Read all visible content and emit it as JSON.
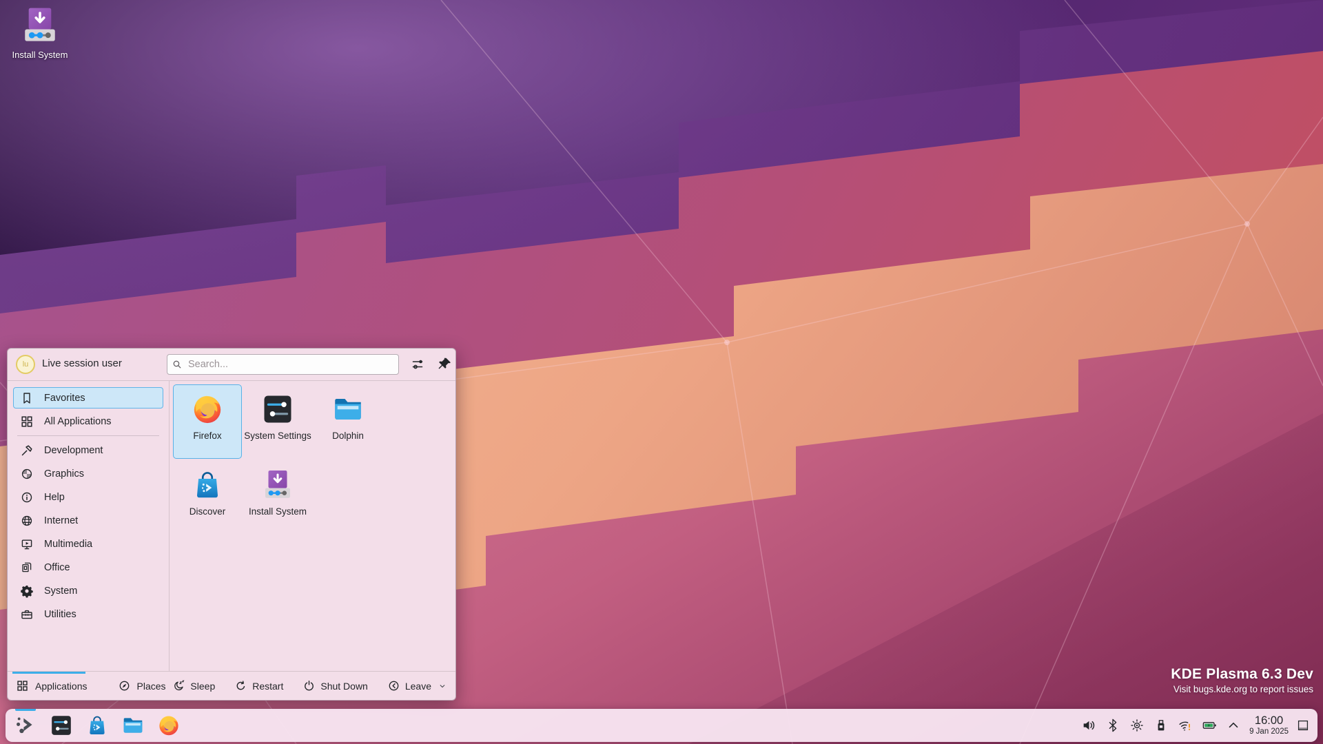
{
  "colors": {
    "accent": "#3daee9",
    "panel_bg": "#f6e3ef",
    "menu_bg": "#f3dee9",
    "highlight_bg": "#cde7f8",
    "text": "#232629",
    "network_warning": "#f39c1f",
    "battery_charge": "#2ea95c"
  },
  "desktop": {
    "install_icon_label": "Install System",
    "branding_title": "KDE Plasma 6.3 Dev",
    "branding_subtitle": "Visit bugs.kde.org to report issues"
  },
  "launcher": {
    "user_name": "Live session user",
    "avatar_initials": "lu",
    "search_placeholder": "Search...",
    "header_buttons": [
      {
        "name": "configure-icon"
      },
      {
        "name": "pin-icon"
      }
    ],
    "sidebar": [
      {
        "label": "Favorites",
        "icon": "bookmark",
        "selected": true
      },
      {
        "label": "All Applications",
        "icon": "grid",
        "divider_after": true
      },
      {
        "label": "Development",
        "icon": "hammer"
      },
      {
        "label": "Graphics",
        "icon": "checker"
      },
      {
        "label": "Help",
        "icon": "info"
      },
      {
        "label": "Internet",
        "icon": "globe"
      },
      {
        "label": "Multimedia",
        "icon": "multimedia"
      },
      {
        "label": "Office",
        "icon": "office"
      },
      {
        "label": "System",
        "icon": "gear"
      },
      {
        "label": "Utilities",
        "icon": "toolbox"
      }
    ],
    "apps": [
      {
        "label": "Firefox",
        "icon": "firefox",
        "selected": true
      },
      {
        "label": "System Settings",
        "icon": "system-settings"
      },
      {
        "label": "Dolphin",
        "icon": "dolphin"
      },
      {
        "label": "Discover",
        "icon": "discover"
      },
      {
        "label": "Install System",
        "icon": "install-system"
      }
    ],
    "footer_tabs": [
      {
        "label": "Applications",
        "icon": "grid",
        "active": true
      },
      {
        "label": "Places",
        "icon": "compass"
      }
    ],
    "session_actions": [
      {
        "label": "Sleep",
        "icon": "sleep"
      },
      {
        "label": "Restart",
        "icon": "restart"
      },
      {
        "label": "Shut Down",
        "icon": "shutdown"
      },
      {
        "label": "Leave",
        "icon": "leave",
        "has_menu": true
      }
    ]
  },
  "taskbar": {
    "pinned": [
      {
        "name": "application-launcher",
        "icon": "kde-launcher",
        "active": true
      },
      {
        "name": "system-settings",
        "icon": "system-settings"
      },
      {
        "name": "discover",
        "icon": "discover"
      },
      {
        "name": "dolphin",
        "icon": "dolphin"
      },
      {
        "name": "firefox",
        "icon": "firefox"
      }
    ],
    "tray": [
      {
        "name": "volume",
        "icon": "volume"
      },
      {
        "name": "bluetooth",
        "icon": "bluetooth"
      },
      {
        "name": "brightness",
        "icon": "brightness"
      },
      {
        "name": "removable-device",
        "icon": "usb"
      },
      {
        "name": "network",
        "icon": "wifi-warning"
      },
      {
        "name": "battery",
        "icon": "battery"
      },
      {
        "name": "expand-tray",
        "icon": "chevron-up"
      }
    ],
    "clock": {
      "time": "16:00",
      "date": "9 Jan 2025"
    }
  }
}
